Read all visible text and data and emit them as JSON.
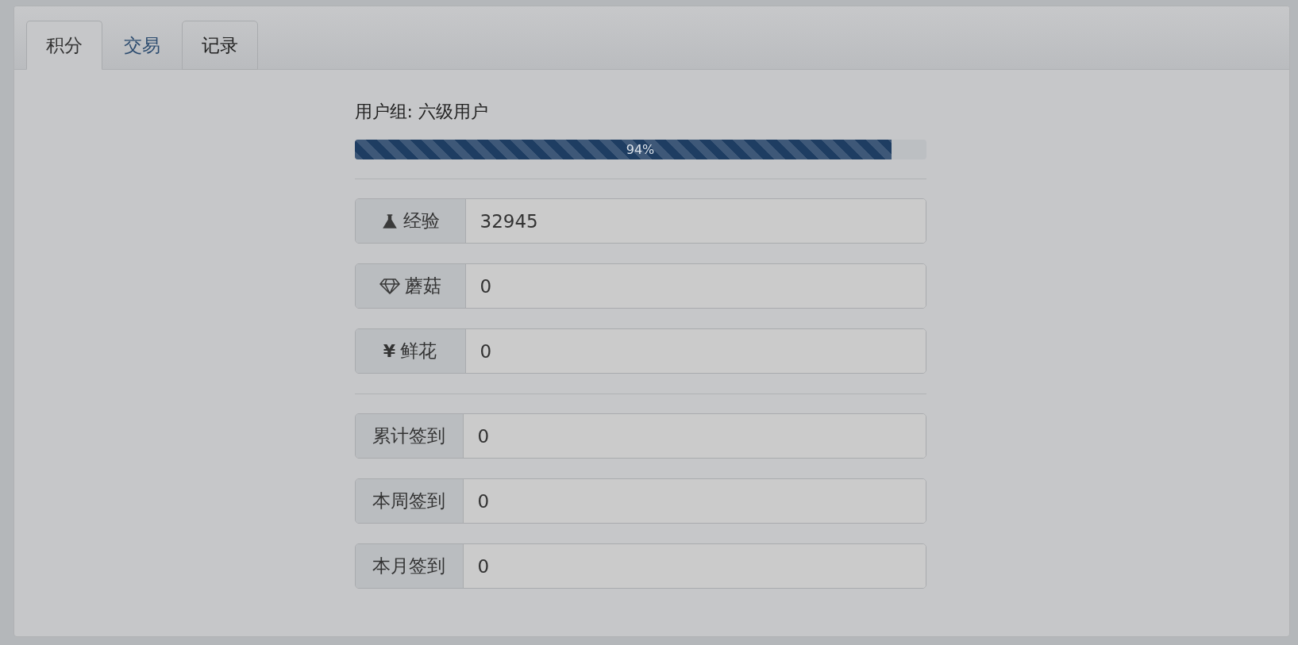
{
  "tabs": [
    {
      "label": "积分",
      "selected": true,
      "outlined": true
    },
    {
      "label": "交易",
      "selected": false,
      "outlined": false
    },
    {
      "label": "记录",
      "selected": false,
      "outlined": true
    }
  ],
  "user_group": "用户组: 六级用户",
  "progress": {
    "level": 0.94,
    "label": "94%"
  },
  "resources": [
    {
      "kind": "flask",
      "label": "经验",
      "value": "32945"
    },
    {
      "kind": "diamond",
      "label": "蘑菇",
      "value": "0"
    },
    {
      "kind": "symbol",
      "symbol": "¥",
      "label": "鲜花",
      "value": "0"
    }
  ],
  "checkins": [
    {
      "label": "累计签到",
      "value": "0"
    },
    {
      "label": "本周签到",
      "value": "0"
    },
    {
      "label": "本月签到",
      "value": "0"
    }
  ]
}
